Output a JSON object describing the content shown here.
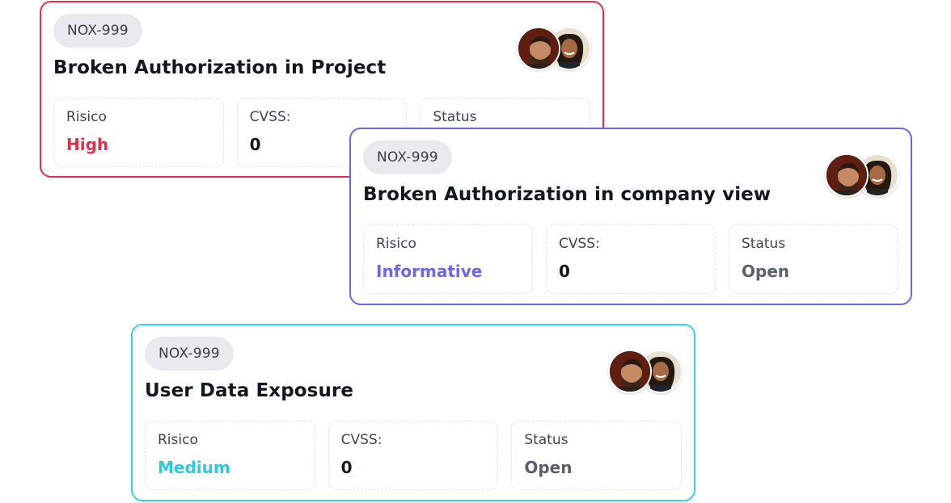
{
  "cards": [
    {
      "id": "NOX-999",
      "title": "Broken Authorization in Project",
      "accent": "#e0304e",
      "stats": {
        "risk_label": "Risico",
        "risk_value": "High",
        "risk_color": "#e0304e",
        "cvss_label": "CVSS:",
        "cvss_value": "0",
        "status_label": "Status",
        "status_value": ""
      }
    },
    {
      "id": "NOX-999",
      "title": "Broken Authorization in company view",
      "accent": "#6a67ea",
      "stats": {
        "risk_label": "Risico",
        "risk_value": "Informative",
        "risk_color": "#6a67ea",
        "cvss_label": "CVSS:",
        "cvss_value": "0",
        "status_label": "Status",
        "status_value": "Open"
      }
    },
    {
      "id": "NOX-999",
      "title": "User Data Exposure",
      "accent": "#37d0dc",
      "stats": {
        "risk_label": "Risico",
        "risk_value": "Medium",
        "risk_color": "#2fc9dc",
        "cvss_label": "CVSS:",
        "cvss_value": "0",
        "status_label": "Status",
        "status_value": "Open"
      }
    }
  ]
}
